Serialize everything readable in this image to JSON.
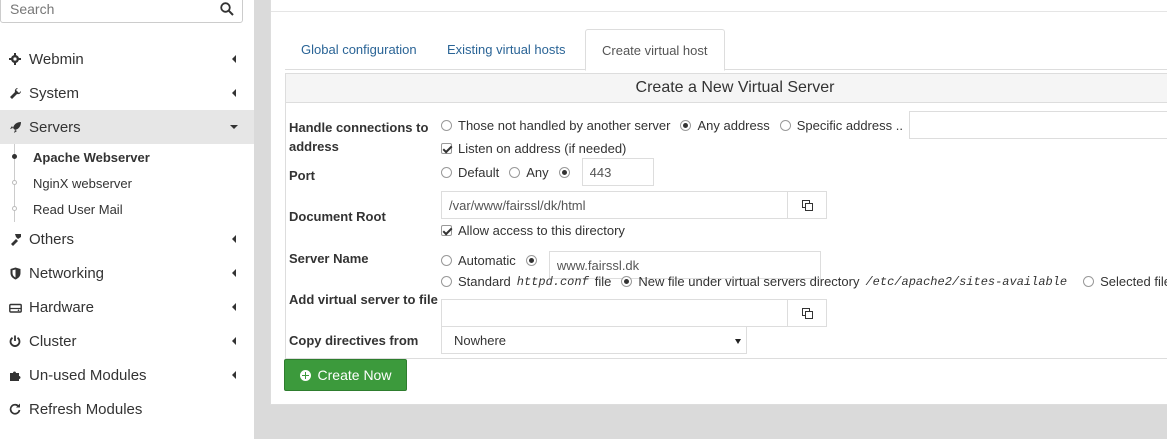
{
  "search": {
    "placeholder": "Search"
  },
  "sidebar": {
    "items": [
      {
        "label": "Webmin",
        "icon": "gear-icon"
      },
      {
        "label": "System",
        "icon": "wrench-icon"
      },
      {
        "label": "Servers",
        "icon": "rocket-icon",
        "expanded": true
      },
      {
        "label": "Others",
        "icon": "tools-icon"
      },
      {
        "label": "Networking",
        "icon": "shield-icon"
      },
      {
        "label": "Hardware",
        "icon": "hdd-icon"
      },
      {
        "label": "Cluster",
        "icon": "power-icon"
      },
      {
        "label": "Un-used Modules",
        "icon": "puzzle-icon"
      },
      {
        "label": "Refresh Modules",
        "icon": "refresh-icon"
      }
    ],
    "servers_sub": [
      {
        "label": "Apache Webserver",
        "current": true
      },
      {
        "label": "NginX webserver"
      },
      {
        "label": "Read User Mail"
      }
    ]
  },
  "tabs": [
    {
      "label": "Global configuration"
    },
    {
      "label": "Existing virtual hosts"
    },
    {
      "label": "Create virtual host",
      "active": true
    }
  ],
  "form": {
    "title": "Create a New Virtual Server",
    "handle_label": "Handle connections to address",
    "handle_opts": [
      "Those not handled by another server",
      "Any address",
      "Specific address .."
    ],
    "handle_selected": "Any address",
    "specific_value": "",
    "listen_label": "Listen on address (if needed)",
    "port_label": "Port",
    "port_opts": [
      "Default",
      "Any"
    ],
    "port_value": "443",
    "docroot_label": "Document Root",
    "docroot_value": "/var/www/fairssl/dk/html",
    "allow_label": "Allow access to this directory",
    "servername_label": "Server Name",
    "servername_auto": "Automatic",
    "servername_value": "www.fairssl.dk",
    "addfile_label": "Add virtual server to file",
    "addfile_standard": "Standard",
    "addfile_conf": "httpd.conf",
    "addfile_file": "file",
    "addfile_new": "New file under virtual servers directory",
    "addfile_dir": "/etc/apache2/sites-available",
    "addfile_selected": "Selected file..",
    "addfile_value": "",
    "copy_label": "Copy directives from",
    "copy_value": "Nowhere"
  },
  "create_button": "Create Now",
  "colors": {
    "create_button": "#3c9a3c",
    "link": "#2a6496"
  }
}
